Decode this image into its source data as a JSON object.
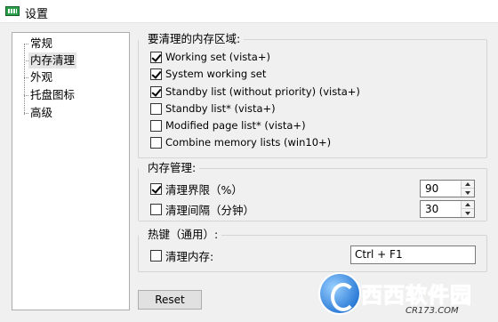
{
  "window": {
    "title": "设置",
    "icon": "app-memory-icon"
  },
  "sidebar": {
    "items": [
      {
        "label": "常规"
      },
      {
        "label": "内存清理",
        "selected": true
      },
      {
        "label": "外观"
      },
      {
        "label": "托盘图标"
      },
      {
        "label": "高级"
      }
    ]
  },
  "memory_areas": {
    "title": "要清理的内存区域:",
    "items": [
      {
        "label": "Working set (vista+)",
        "checked": true
      },
      {
        "label": "System working set",
        "checked": true
      },
      {
        "label": "Standby list (without priority) (vista+)",
        "checked": true
      },
      {
        "label": "Standby list* (vista+)",
        "checked": false
      },
      {
        "label": "Modified page list* (vista+)",
        "checked": false
      },
      {
        "label": "Combine memory lists (win10+)",
        "checked": false
      }
    ]
  },
  "memory_management": {
    "title": "内存管理:",
    "threshold": {
      "label": "清理界限（%）",
      "checked": true,
      "value": "90"
    },
    "interval": {
      "label": "清理间隔（分钟）",
      "checked": false,
      "value": "30"
    }
  },
  "hotkey": {
    "title": "热键（通用）:",
    "clean": {
      "label": "清理内存:",
      "checked": false,
      "value": "Ctrl + F1"
    }
  },
  "buttons": {
    "reset": "Reset"
  },
  "watermark": {
    "brand_a": "西西",
    "brand_b": "软件园",
    "url": "CR173.COM"
  }
}
